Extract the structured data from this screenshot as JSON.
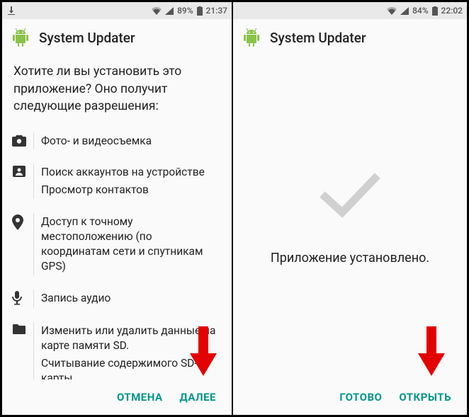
{
  "left": {
    "status": {
      "battery": "89%",
      "time": "21:37"
    },
    "app_title": "System Updater",
    "prompt": "Хотите ли вы установить это приложение? Оно получит следующие разрешения:",
    "permissions": [
      {
        "icon": "camera",
        "lines": [
          "Фото- и видеосъемка"
        ]
      },
      {
        "icon": "contacts",
        "lines": [
          "Поиск аккаунтов на устройстве",
          "Просмотр контактов"
        ]
      },
      {
        "icon": "location",
        "lines": [
          "Доступ к точному местоположению (по координатам сети и спутникам GPS)"
        ]
      },
      {
        "icon": "mic",
        "lines": [
          "Запись аудио"
        ]
      },
      {
        "icon": "folder",
        "lines": [
          "Изменить или удалить данные на карте памяти SD.",
          "Считывание содержимого SD-карты"
        ]
      }
    ],
    "buttons": {
      "cancel": "ОТМЕНА",
      "next": "ДАЛЕЕ"
    }
  },
  "right": {
    "status": {
      "battery": "84%",
      "time": "22:02"
    },
    "app_title": "System Updater",
    "installed_text": "Приложение установлено.",
    "buttons": {
      "done": "ГОТОВО",
      "open": "ОТКРЫТЬ"
    }
  },
  "colors": {
    "accent": "#009688",
    "arrow": "#e30000",
    "android": "#8bc34a"
  }
}
